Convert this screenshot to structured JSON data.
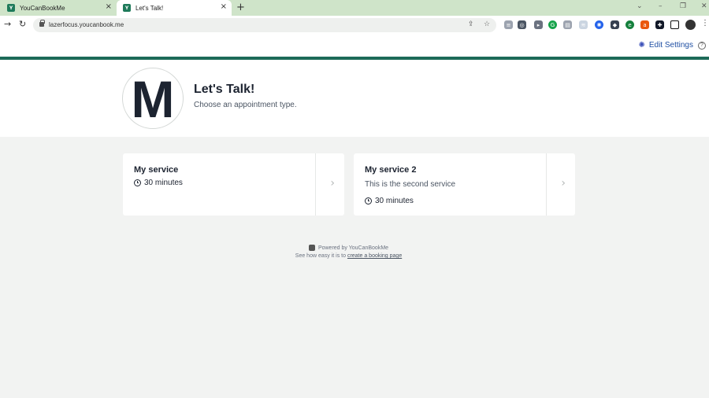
{
  "browser": {
    "tabs": [
      {
        "title": "YouCanBookMe",
        "active": false
      },
      {
        "title": "Let's Talk!",
        "active": true
      }
    ],
    "url": "lazerfocus.youcanbook.me"
  },
  "header": {
    "edit_settings_label": "Edit Settings"
  },
  "profile": {
    "logo_letter": "M",
    "title": "Let's Talk!",
    "subtitle": "Choose an appointment type."
  },
  "services": [
    {
      "title": "My service",
      "description": "",
      "duration": "30 minutes"
    },
    {
      "title": "My service 2",
      "description": "This is the second service",
      "duration": "30 minutes"
    }
  ],
  "footer": {
    "powered_by": "Powered by YouCanBookMe",
    "see_how_prefix": "See how easy it is to",
    "link_text": "create a booking page"
  },
  "colors": {
    "brand_green": "#1d6a58",
    "tabbar": "#cfe4c9",
    "link_blue": "#1f4fa3"
  }
}
